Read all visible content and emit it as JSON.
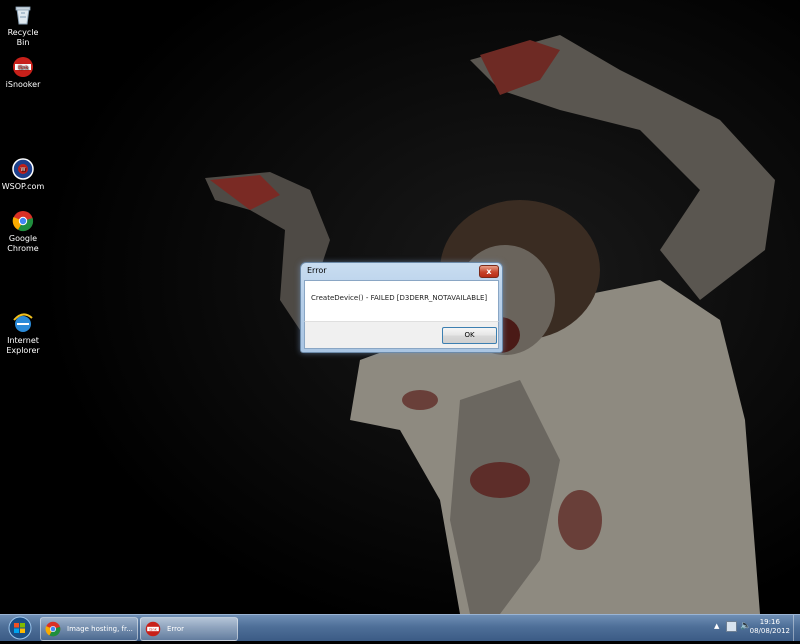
{
  "desktop_icons": [
    {
      "label": "Recycle Bin",
      "icon": "recycle-bin-icon"
    },
    {
      "label": "iSnooker",
      "icon": "isnooker-icon"
    },
    {
      "label": "WSOP.com",
      "icon": "wsop-icon"
    },
    {
      "label": "Google\nChrome",
      "icon": "chrome-icon"
    },
    {
      "label": "Internet\nExplorer",
      "icon": "ie-icon"
    }
  ],
  "dialog": {
    "title": "Error",
    "close_glyph": "x",
    "message": "CreateDevice() - FAILED [D3DERR_NOTAVAILABLE]",
    "ok_label": "OK"
  },
  "taskbar": {
    "buttons": [
      {
        "label": "Image hosting, fr...",
        "icon": "chrome-icon"
      },
      {
        "label": "Error",
        "icon": "isnooker-icon"
      }
    ],
    "clock_time": "19:16",
    "clock_date": "08/08/2012"
  },
  "colors": {
    "taskbar": "#4e6f98",
    "dialog_frame": "#b6cfe9",
    "close_button": "#c7432a"
  }
}
